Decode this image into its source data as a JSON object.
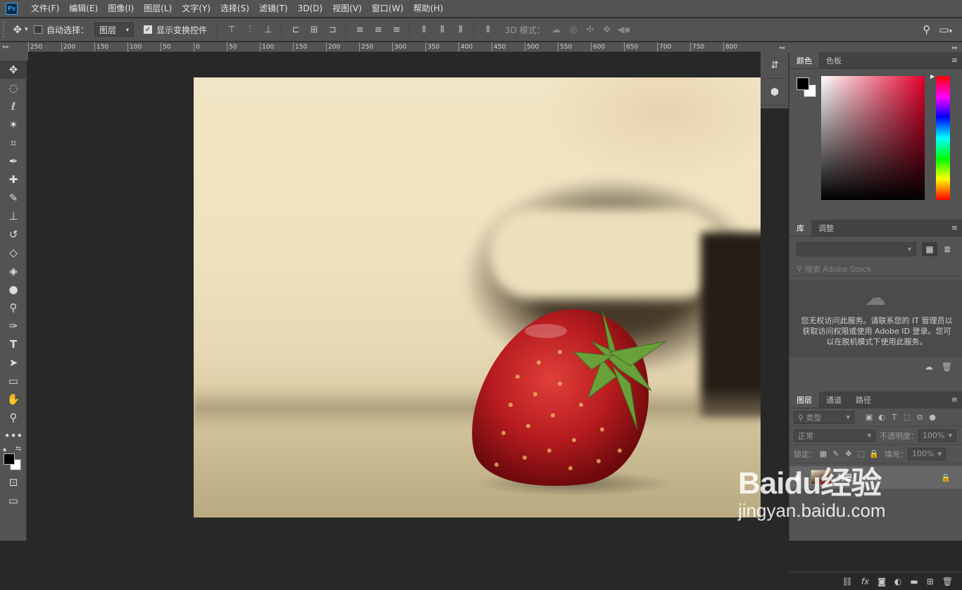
{
  "app": {
    "logo": "Ps"
  },
  "menu": [
    "文件(F)",
    "编辑(E)",
    "图像(I)",
    "图层(L)",
    "文字(Y)",
    "选择(S)",
    "滤镜(T)",
    "3D(D)",
    "视图(V)",
    "窗口(W)",
    "帮助(H)"
  ],
  "options": {
    "auto_select_label": "自动选择：",
    "auto_select_target": "图层",
    "show_transform_label": "显示变换控件",
    "mode3d_label": "3D 模式："
  },
  "ruler": {
    "ticks": [
      "250",
      "200",
      "150",
      "100",
      "50",
      "0",
      "50",
      "100",
      "150",
      "200",
      "250",
      "300",
      "350",
      "400",
      "450",
      "500",
      "550",
      "600",
      "650",
      "700",
      "750",
      "800"
    ]
  },
  "panels": {
    "color": {
      "tabs": [
        "颜色",
        "色板"
      ],
      "fg": "#000000",
      "bg": "#ffffff"
    },
    "library": {
      "tabs": [
        "库",
        "调整"
      ],
      "search_placeholder": "搜索 Adobe Stock",
      "message": "您无权访问此服务。请联系您的 IT 管理员以获取访问权限或使用 Adobe ID 登录。您可以在脱机模式下使用此服务。"
    },
    "layers": {
      "tabs": [
        "图层",
        "通道",
        "路径"
      ],
      "filter_kind": "类型",
      "blend_mode": "正常",
      "opacity_label": "不透明度：",
      "opacity_value": "100%",
      "lock_label": "锁定：",
      "fill_label": "填充：",
      "fill_value": "100%",
      "items": [
        {
          "name": "背景"
        }
      ]
    }
  },
  "watermark": {
    "logo": "Baidu经验",
    "url": "jingyan.baidu.com"
  }
}
